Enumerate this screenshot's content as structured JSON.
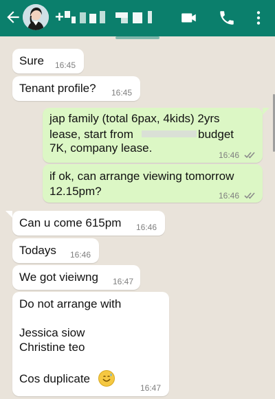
{
  "header": {
    "contact_name_prefix": "+",
    "icons": [
      "back-arrow-icon",
      "video-call-icon",
      "phone-icon",
      "more-vert-icon"
    ]
  },
  "messages": [
    {
      "direction": "in",
      "text": "Sure",
      "time": "16:45"
    },
    {
      "direction": "in",
      "text": "Tenant profile?",
      "time": "16:45"
    },
    {
      "direction": "out",
      "lines": [
        "jap family (total 6pax, 4kids) 2yrs",
        "lease, start from",
        "budget",
        "7K, company lease."
      ],
      "time": "16:46",
      "status": "read"
    },
    {
      "direction": "out",
      "lines": [
        "if ok, can arrange viewing tomorrow",
        "12.15pm?"
      ],
      "time": "16:46",
      "status": "read"
    },
    {
      "direction": "in",
      "text": "Can u come 615pm",
      "time": "16:46"
    },
    {
      "direction": "in",
      "text": "Todays",
      "time": "16:46"
    },
    {
      "direction": "in",
      "text": "We got vieiwng",
      "time": "16:47"
    },
    {
      "direction": "in",
      "lines": [
        "Do not arrange with",
        "",
        "Jessica siow",
        "Christine teo",
        "",
        "Cos duplicate"
      ],
      "time": "16:47"
    }
  ],
  "colors": {
    "header": "#0b7f6c",
    "incoming_bubble": "#ffffff",
    "outgoing_bubble": "#dcf7c5",
    "read_ticks": "#8a8a8a",
    "background": "#e9e3da"
  }
}
